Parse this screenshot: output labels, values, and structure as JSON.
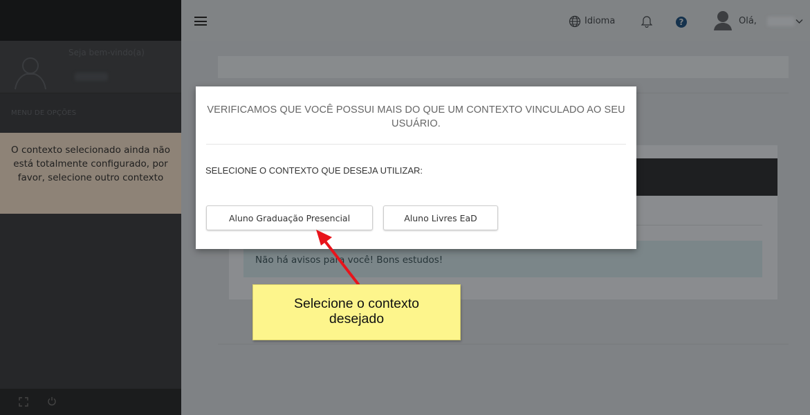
{
  "sidebar": {
    "welcome": "Seja bem-vindo(a)",
    "menu_title": "MENU DE OPÇÕES",
    "notice": "O contexto selecionado ainda não está totalmente configurado, por favor, selecione outro contexto"
  },
  "topbar": {
    "language_label": "Idioma",
    "help_glyph": "?",
    "greeting": "Olá,"
  },
  "main": {
    "alert_text": "Não há avisos para você! Bons estudos!"
  },
  "modal": {
    "title": "VERIFICAMOS QUE VOCÊ POSSUI MAIS DO QUE UM CONTEXTO VINCULADO AO SEU USUÁRIO.",
    "prompt": "SELECIONE O CONTEXTO QUE DESEJA UTILIZAR:",
    "options": [
      {
        "label": "Aluno Graduação Presencial"
      },
      {
        "label": "Aluno Livres EaD"
      }
    ]
  },
  "annotation": {
    "line1": "Selecione o contexto",
    "line2": "desejado"
  },
  "colors": {
    "arrow": "#e8141b",
    "callout_bg": "#fdf58c",
    "notice_bg": "#8e8377"
  }
}
